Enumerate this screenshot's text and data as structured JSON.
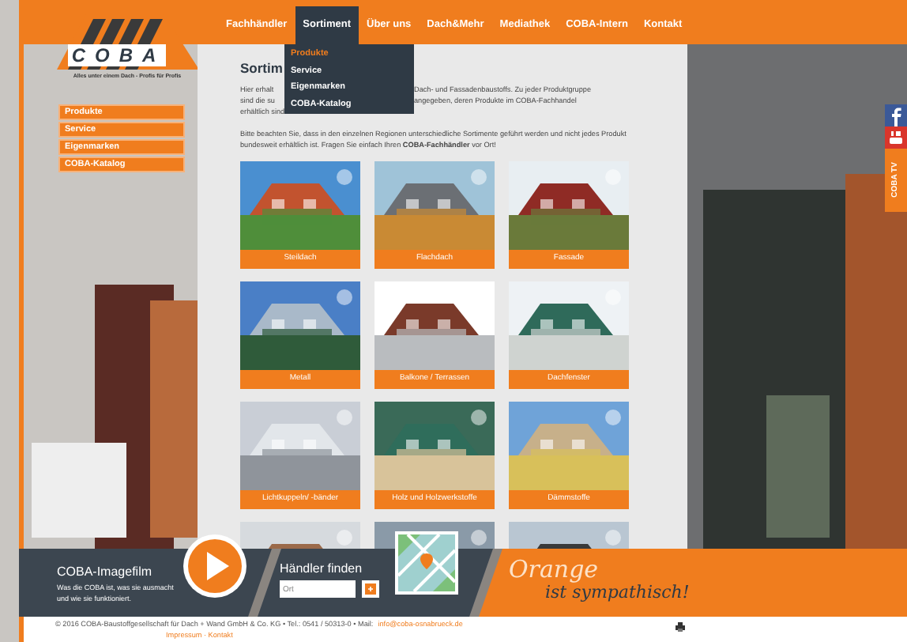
{
  "logo": {
    "text": "COBA",
    "tagline": "Alles unter einem Dach - Profis für Profis"
  },
  "nav": [
    {
      "label": "Fachhändler",
      "selected": false
    },
    {
      "label": "Sortiment",
      "selected": true
    },
    {
      "label": "Über uns",
      "selected": false
    },
    {
      "label": "Dach&Mehr",
      "selected": false
    },
    {
      "label": "Mediathek",
      "selected": false
    },
    {
      "label": "COBA-Intern",
      "selected": false
    },
    {
      "label": "Kontakt",
      "selected": false
    }
  ],
  "dropdown": [
    {
      "label": "Produkte",
      "selected": true
    },
    {
      "label": "Service",
      "selected": false
    },
    {
      "label": "Eigenmarken",
      "selected": false
    },
    {
      "label": "COBA-Katalog",
      "selected": false
    }
  ],
  "sidebar": {
    "items": [
      "Produkte",
      "Service",
      "Eigenmarken",
      "COBA-Katalog"
    ]
  },
  "content": {
    "heading": "Sortim",
    "intro_lines": [
      {
        "left": "Hier erhalt",
        "right": "Dach- und Fassadenbaustoffs. Zu jeder Produktgruppe"
      },
      {
        "left": "sind die su",
        "right": "angegeben, deren Produkte im COBA-Fachhandel"
      },
      {
        "left": "erhältlich sind."
      }
    ],
    "note": "Bitte beachten Sie, dass in den einzelnen Regionen unterschiedliche Sortimente geführt werden und nicht jedes Produkt bundesweit erhältlich ist. Fragen Sie einfach Ihren **COBA-Fachhändler** vor Ort!",
    "tiles": [
      {
        "kind": "tile",
        "label": "Steildach"
      },
      {
        "kind": "tile",
        "label": "Flachdach"
      },
      {
        "kind": "tile",
        "label": "Fassade"
      },
      {
        "kind": "tile",
        "label": "Metall"
      },
      {
        "kind": "tile",
        "label": "Balkone / Terrassen"
      },
      {
        "kind": "tile",
        "label": "Dachfenster"
      },
      {
        "kind": "tile",
        "label": "Lichtkuppeln/ -bänder"
      },
      {
        "kind": "tile",
        "label": "Holz und Holzwerkstoffe"
      },
      {
        "kind": "tile",
        "label": "Dämmstoffe"
      },
      {
        "kind": "picture"
      },
      {
        "kind": "picture"
      },
      {
        "kind": "picture"
      }
    ]
  },
  "social": {
    "tv_label": "COBA TV"
  },
  "bottom_band": {
    "film_title": "COBA-Imagefilm",
    "film_text": "Was die COBA ist, was sie ausmacht und wie sie funktioniert.",
    "dealer_title": "Händler finden",
    "dealer_placeholder": "Ort",
    "slogan_1": "Orange",
    "slogan_2": "ist sympathisch!"
  },
  "footer": {
    "text": "© 2016 COBA-Baustoffgesellschaft für Dach + Wand GmbH & Co. KG • Tel.: 0541 / 50313-0 • Mail:",
    "email": "info@coba-osnabrueck.de",
    "links": "Impressum · Kontakt"
  }
}
